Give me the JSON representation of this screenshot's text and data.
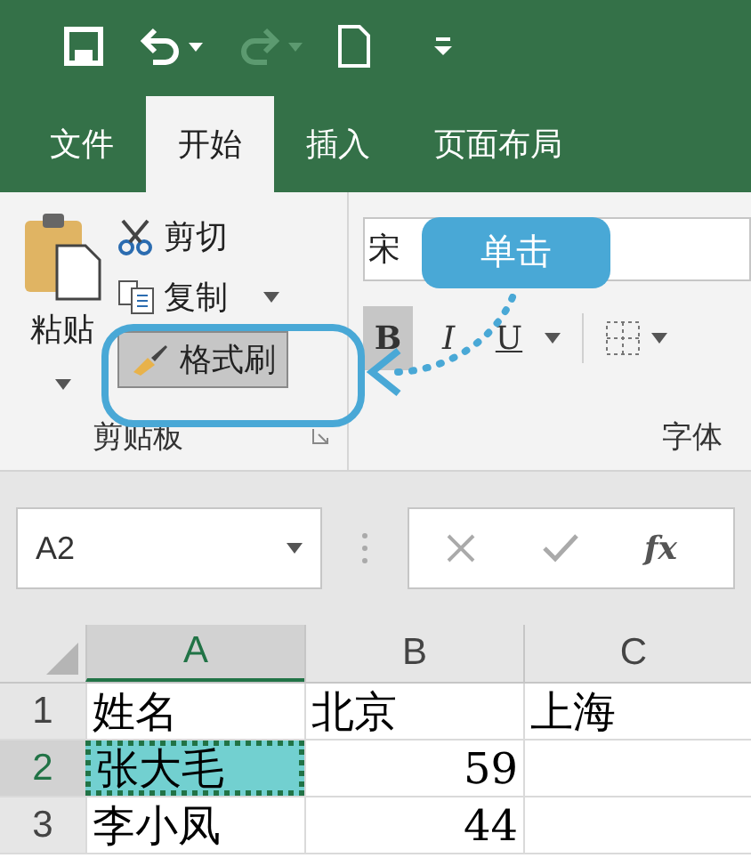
{
  "tabs": [
    {
      "label": "文件",
      "selected": false
    },
    {
      "label": "开始",
      "selected": true
    },
    {
      "label": "插入",
      "selected": false
    },
    {
      "label": "页面布局",
      "selected": false
    }
  ],
  "clipboard": {
    "paste": "粘贴",
    "cut": "剪切",
    "copy": "复制",
    "format_painter": {
      "label": "格式刷",
      "on": true
    },
    "group_label": "剪贴板"
  },
  "font": {
    "font_name": "宋",
    "buttons": [
      {
        "label": "B",
        "selected": true
      },
      {
        "label": "I",
        "selected": false
      },
      {
        "label": "U",
        "selected": false
      }
    ],
    "group_label": "字体"
  },
  "callout": {
    "text": "单击"
  },
  "name_box": "A2",
  "formula_bar": {
    "function_label": "fx"
  },
  "sheet": {
    "columns": [
      {
        "label": "A",
        "selected": true
      },
      {
        "label": "B",
        "selected": false
      },
      {
        "label": "C",
        "selected": false
      }
    ],
    "rows": [
      {
        "number": "1",
        "selected": false,
        "cells": [
          {
            "text": "姓名",
            "kind": "text",
            "selected": false
          },
          {
            "text": "北京",
            "kind": "text",
            "selected": false
          },
          {
            "text": "上海",
            "kind": "text",
            "selected": false
          }
        ]
      },
      {
        "number": "2",
        "selected": true,
        "cells": [
          {
            "text": "张大毛",
            "kind": "text",
            "selected": true
          },
          {
            "text": "59",
            "kind": "number",
            "selected": false
          }
        ]
      },
      {
        "number": "3",
        "selected": false,
        "cells": [
          {
            "text": "李小凤",
            "kind": "text",
            "selected": false
          },
          {
            "text": "44",
            "kind": "number",
            "selected": false
          }
        ]
      }
    ]
  }
}
